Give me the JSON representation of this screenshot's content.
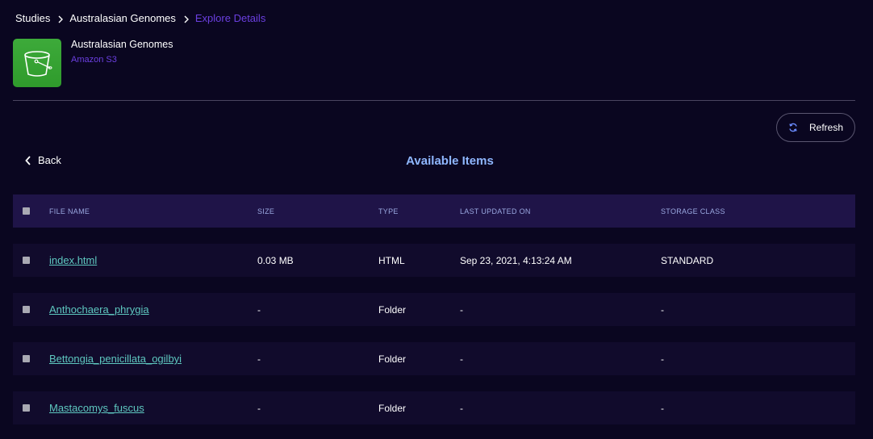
{
  "breadcrumb": {
    "items": [
      "Studies",
      "Australasian Genomes"
    ],
    "current": "Explore Details"
  },
  "header": {
    "title": "Australasian Genomes",
    "source": "Amazon S3",
    "logo_icon": "s3-bucket-icon"
  },
  "toolbar": {
    "refresh_label": "Refresh",
    "back_label": "Back"
  },
  "section_title": "Available Items",
  "table": {
    "columns": [
      "FILE NAME",
      "SIZE",
      "TYPE",
      "LAST UPDATED ON",
      "STORAGE CLASS"
    ],
    "rows": [
      {
        "name": "index.html",
        "size": "0.03 MB",
        "type": "HTML",
        "updated": "Sep 23, 2021, 4:13:24 AM",
        "storage_class": "STANDARD"
      },
      {
        "name": "Anthochaera_phrygia",
        "size": "-",
        "type": "Folder",
        "updated": "-",
        "storage_class": "-"
      },
      {
        "name": "Bettongia_penicillata_ogilbyi",
        "size": "-",
        "type": "Folder",
        "updated": "-",
        "storage_class": "-"
      },
      {
        "name": "Mastacomys_fuscus",
        "size": "-",
        "type": "Folder",
        "updated": "-",
        "storage_class": "-"
      }
    ]
  },
  "colors": {
    "background": "#0a0620",
    "accent_purple": "#6b3fe0",
    "link_teal": "#5ec8c0",
    "title_blue": "#8fb7ff",
    "table_header_bg": "#1f1448",
    "row_bg": "#110b2c",
    "logo_green": "#3daa3a"
  }
}
